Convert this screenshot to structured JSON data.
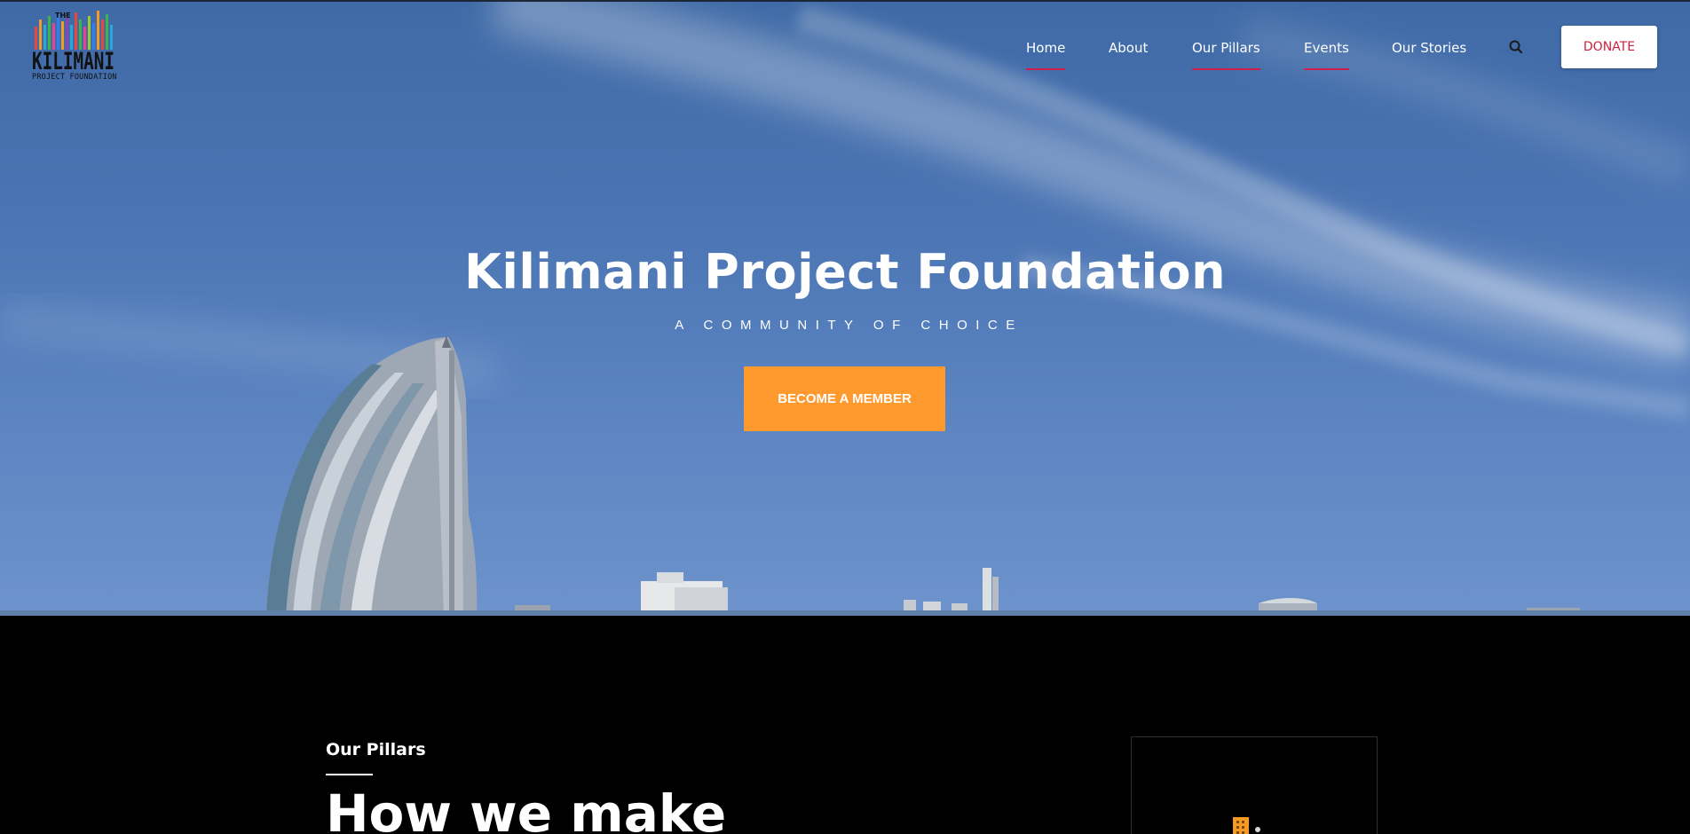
{
  "brand": {
    "logo_top": "THE",
    "logo_main": "KILIMANI",
    "logo_sub": "PROJECT FOUNDATION",
    "logo_colors": [
      "#e8473b",
      "#f59a23",
      "#2aa8d8",
      "#3cb54a",
      "#8e44ad",
      "#e84393",
      "#2f80ed",
      "#9acd32"
    ]
  },
  "nav": {
    "items": [
      {
        "label": "Home",
        "active": true
      },
      {
        "label": "About",
        "active": false
      },
      {
        "label": "Our Pillars",
        "active": true
      },
      {
        "label": "Events",
        "active": true
      },
      {
        "label": "Our Stories",
        "active": false
      }
    ],
    "search_icon": "search-icon",
    "donate_label": "DONATE"
  },
  "hero": {
    "title": "Kilimani Project Foundation",
    "tagline": "A COMMUNITY OF CHOICE",
    "cta_label": "BECOME A MEMBER"
  },
  "pillars": {
    "eyebrow": "Our Pillars",
    "heading": "How we make",
    "media_icon": "building-icon"
  },
  "colors": {
    "accent_underline": "#d11d4b",
    "donate_text": "#cc1f3f",
    "cta_bg": "#ff9a2f",
    "section_bg": "#000000"
  }
}
